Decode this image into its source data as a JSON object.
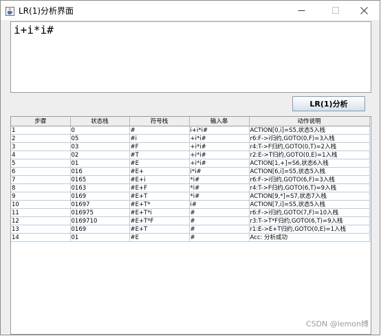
{
  "window": {
    "title": "LR(1)分析界面"
  },
  "input": {
    "text": "i+i*i#"
  },
  "analyze_button": {
    "label": "LR(1)分析"
  },
  "table": {
    "headers": [
      "步骤",
      "状态栈",
      "符号栈",
      "输入串",
      "动作说明"
    ],
    "rows": [
      [
        "1",
        "0",
        "#",
        "i+i*i#",
        "ACTION[0,i]=S5,状态5入栈"
      ],
      [
        "2",
        "05",
        "#i",
        "+i*i#",
        "r6:F->i归约,GOTO(0,F)=3入栈"
      ],
      [
        "3",
        "03",
        "#F",
        "+i*i#",
        "r4:T->F归约,GOTO(0,T)=2入栈"
      ],
      [
        "4",
        "02",
        "#T",
        "+i*i#",
        "r2:E->T归约,GOTO(0,E)=1入栈"
      ],
      [
        "5",
        "01",
        "#E",
        "+i*i#",
        "ACTION[1,+]=S6,状态6入栈"
      ],
      [
        "6",
        "016",
        "#E+",
        "i*i#",
        "ACTION[6,i]=S5,状态5入栈"
      ],
      [
        "7",
        "0165",
        "#E+i",
        "*i#",
        "r6:F->i归约,GOTO(6,F)=3入栈"
      ],
      [
        "8",
        "0163",
        "#E+F",
        "*i#",
        "r4:T->F归约,GOTO(6,T)=9入栈"
      ],
      [
        "9",
        "0169",
        "#E+T",
        "*i#",
        "ACTION[9,*]=S7,状态7入栈"
      ],
      [
        "10",
        "01697",
        "#E+T*",
        "i#",
        "ACTION[7,i]=S5,状态5入栈"
      ],
      [
        "11",
        "016975",
        "#E+T*i",
        "#",
        "r6:F->i归约,GOTO(7,F)=10入栈"
      ],
      [
        "12",
        "0169710",
        "#E+T*F",
        "#",
        "r3:T->T*F归约,GOTO(6,T)=9入栈"
      ],
      [
        "13",
        "0169",
        "#E+T",
        "#",
        "r1:E->E+T归约,GOTO(0,E)=1入栈"
      ],
      [
        "14",
        "01",
        "#E",
        "#",
        "Acc: 分析成功"
      ]
    ]
  },
  "watermark": {
    "text": "CSDN @lemon缚"
  },
  "icons": {
    "app": "java-cup-icon",
    "minimize": "minimize-icon",
    "maximize": "maximize-icon",
    "close": "close-icon"
  },
  "colors": {
    "grid_line": "#b8cbe0",
    "title_bg": "#ffffff",
    "window_bg": "#eeeeee"
  }
}
